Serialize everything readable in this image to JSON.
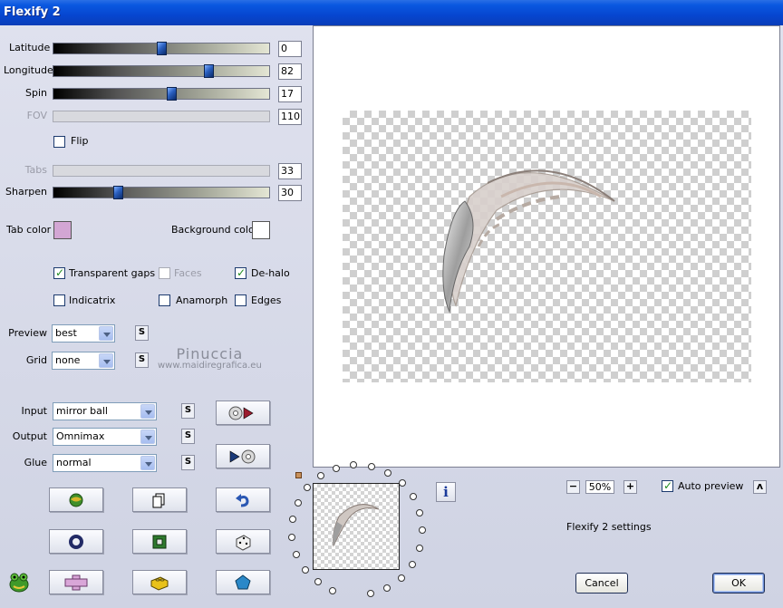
{
  "window": {
    "title": "Flexify 2"
  },
  "sliders": [
    {
      "label": "Latitude",
      "value": "0",
      "position": 0.5,
      "enabled": true
    },
    {
      "label": "Longitude",
      "value": "82",
      "position": 0.72,
      "enabled": true
    },
    {
      "label": "Spin",
      "value": "17",
      "position": 0.545,
      "enabled": true
    },
    {
      "label": "FOV",
      "value": "110",
      "enabled": false
    },
    {
      "label": "Tabs",
      "value": "33",
      "enabled": false
    },
    {
      "label": "Sharpen",
      "value": "30",
      "position": 0.3,
      "enabled": true
    }
  ],
  "flip": {
    "label": "Flip",
    "checked": false
  },
  "colors": {
    "tab_color_label": "Tab color",
    "tab_color": "#d3a6d4",
    "background_color_label": "Background color",
    "background_color": "#ffffff"
  },
  "options": {
    "transparent_gaps": {
      "label": "Transparent gaps",
      "checked": true
    },
    "faces": {
      "label": "Faces",
      "checked": false,
      "enabled": false
    },
    "de_halo": {
      "label": "De-halo",
      "checked": true
    },
    "indicatrix": {
      "label": "Indicatrix",
      "checked": false
    },
    "anamorph": {
      "label": "Anamorph",
      "checked": false
    },
    "edges": {
      "label": "Edges",
      "checked": false
    }
  },
  "preview_select": {
    "label": "Preview",
    "value": "best"
  },
  "grid_select": {
    "label": "Grid",
    "value": "none"
  },
  "input_select": {
    "label": "Input",
    "value": "mirror ball"
  },
  "output_select": {
    "label": "Output",
    "value": "Omnimax"
  },
  "glue_select": {
    "label": "Glue",
    "value": "normal"
  },
  "small_button_label": "S",
  "watermark": {
    "name": "Pinuccia",
    "url": "www.maidiregrafica.eu"
  },
  "zoom": {
    "minus": "−",
    "value": "50%",
    "plus": "+"
  },
  "auto_preview": {
    "label": "Auto preview",
    "checked": true,
    "toggle": "ʌ"
  },
  "settings_label": "Flexify 2 settings",
  "info_label": "i",
  "buttons": {
    "cancel": "Cancel",
    "ok": "OK"
  }
}
